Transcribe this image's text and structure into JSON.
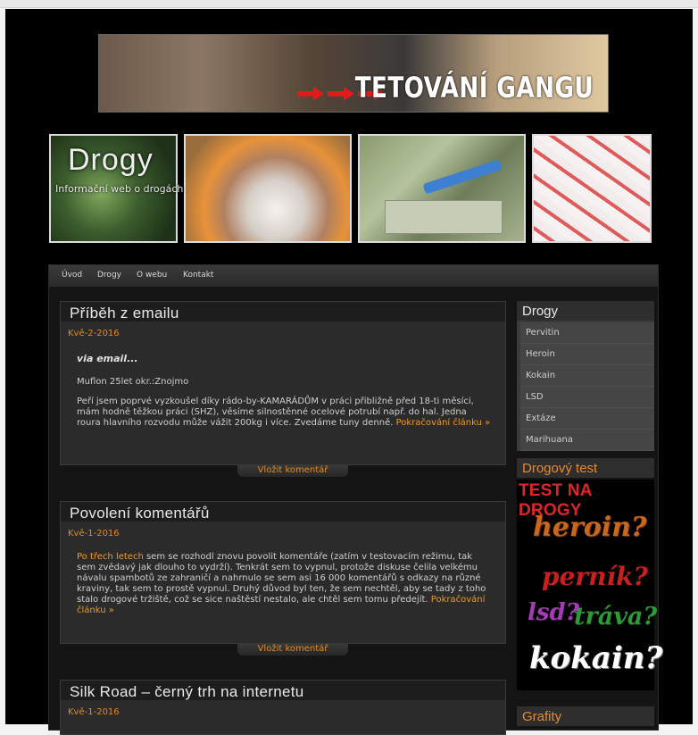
{
  "banner": {
    "title": "TETOVÁNÍ GANGU"
  },
  "site": {
    "title": "Drogy",
    "subtitle": "Informační web o drogách"
  },
  "nav": [
    "Úvod",
    "Drogy",
    "O webu",
    "Kontakt"
  ],
  "posts": [
    {
      "title": "Příběh z emailu",
      "date": "Kvě-2-2016",
      "via": "via email...",
      "author": "Muflon 25let okr.:Znojmo",
      "text": "Peří jsem poprvé vyzkoušel díky rádo-by-KAMARÁDŮM v práci přibližně před 18-ti měsíci, mám hodně těžkou práci (SHZ), věsíme silnostěnné ocelové potrubí např. do hal. Jedna roura hlavního rozvodu může vážit 200kg i více. Zvedáme tuny denně.",
      "more": "Pokračování článku »",
      "comment": "Vložit komentář"
    },
    {
      "title": "Povolení komentářů",
      "date": "Kvě-1-2016",
      "lead": "Po třech letech",
      "text": " sem se rozhodl znovu povolit komentáře (zatím v testovacím režimu, tak sem zvědavý jak dlouho to vydrží). Tenkrát sem to vypnul, protože diskuse čelila velkému návalu spambotů ze zahraničí a nahrnulo se sem asi 16 000 komentářů s odkazy na různé kraviny, tak sem to prostě vypnul. Druhý důvod byl ten, že sem nechtěl, aby se tady z toho stalo drogové tržiště, což se sice naštěstí nestalo, ale chtěl sem tomu předejít.",
      "more": "Pokračování článku »",
      "comment": "Vložit komentář"
    },
    {
      "title": "Silk Road – černý trh na internetu",
      "date": "Kvě-1-2016"
    }
  ],
  "sidebar": {
    "drogy_title": "Drogy",
    "drogy_items": [
      "Pervitin",
      "Heroin",
      "Kokain",
      "LSD",
      "Extáze",
      "Marihuana"
    ],
    "test_title": "Drogový test",
    "test_image_title": "TEST NA DROGY",
    "test_words": [
      "heroin?",
      "perník?",
      "lsd?",
      "tráva?",
      "kokain?"
    ],
    "graf_title": "Grafity"
  },
  "colors": {
    "accent": "#e68a1e",
    "background": "#000000",
    "panel": "#2b2b2b",
    "test_red": "#e02525"
  }
}
